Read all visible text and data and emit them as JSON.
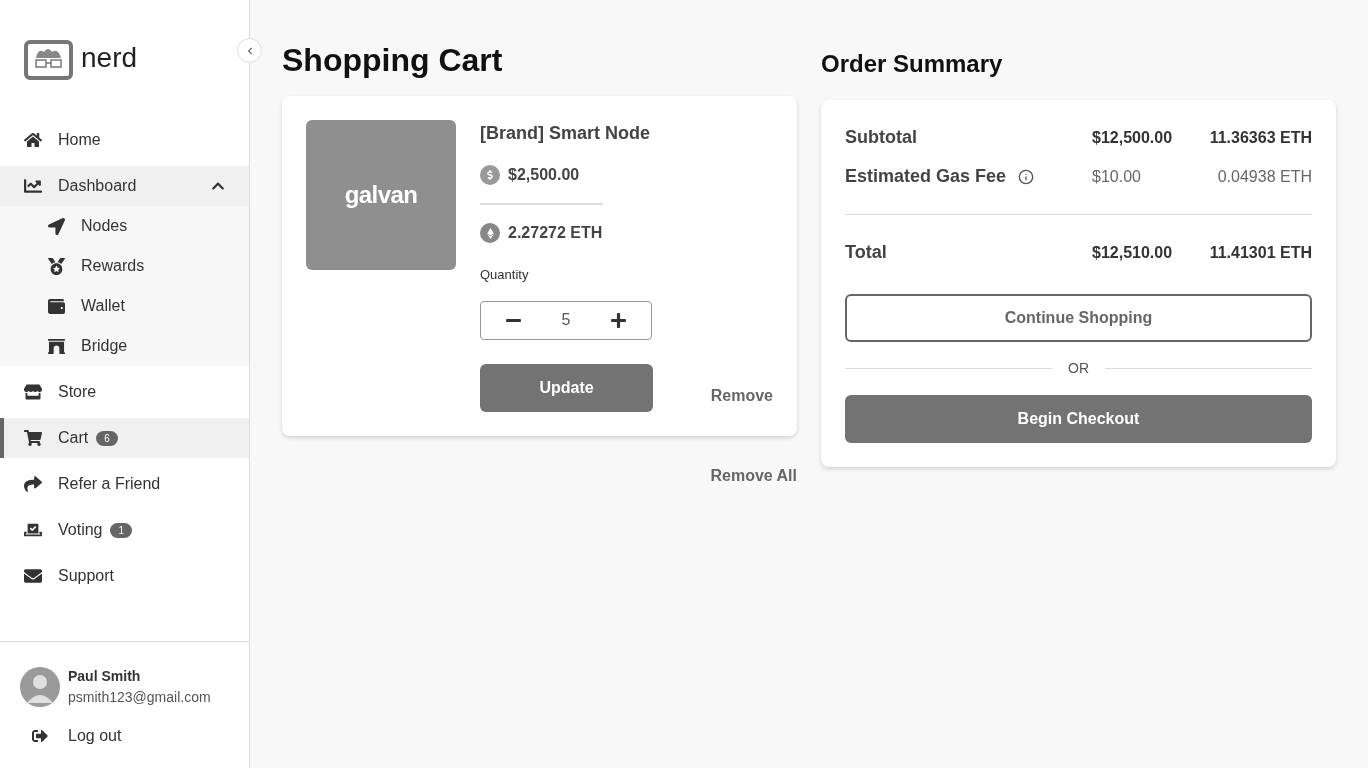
{
  "sidebar": {
    "brand": "nerd",
    "items": [
      {
        "label": "Home",
        "kind": "home",
        "selected": false
      },
      {
        "label": "Dashboard",
        "kind": "chart",
        "selected": false,
        "expanded": true,
        "children": [
          {
            "label": "Nodes",
            "kind": "nodes"
          },
          {
            "label": "Rewards",
            "kind": "medal"
          },
          {
            "label": "Wallet",
            "kind": "wallet"
          },
          {
            "label": "Bridge",
            "kind": "bridge"
          }
        ]
      },
      {
        "label": "Store",
        "kind": "store",
        "selected": false
      },
      {
        "label": "Cart",
        "kind": "cart",
        "selected": true,
        "badge": "6"
      },
      {
        "label": "Refer a Friend",
        "kind": "share",
        "selected": false
      },
      {
        "label": "Voting",
        "kind": "vote",
        "selected": false,
        "badge": "1"
      },
      {
        "label": "Support",
        "kind": "mail",
        "selected": false
      }
    ],
    "user": {
      "name": "Paul Smith",
      "email": "psmith123@gmail.com"
    },
    "logout": "Log out"
  },
  "cart": {
    "title": "Shopping Cart",
    "items": [
      {
        "image_logo": "galvan",
        "name": "[Brand] Smart Node",
        "price_usd": "$2,500.00",
        "price_eth": "2.27272 ETH",
        "quantity_label": "Quantity",
        "quantity": "5",
        "update": "Update",
        "remove": "Remove"
      }
    ],
    "remove_all": "Remove All"
  },
  "summary": {
    "title": "Order Summary",
    "rows": [
      {
        "label": "Subtotal",
        "usd": "$12,500.00",
        "eth": "11.36363 ETH",
        "kind": "subtotal"
      },
      {
        "label": "Estimated Gas Fee",
        "usd": "$10.00",
        "eth": "0.04938 ETH",
        "kind": "fee"
      },
      {
        "label": "Total",
        "usd": "$12,510.00",
        "eth": "11.41301 ETH",
        "kind": "total"
      }
    ],
    "continue": "Continue Shopping",
    "or": "OR",
    "checkout": "Begin Checkout"
  }
}
